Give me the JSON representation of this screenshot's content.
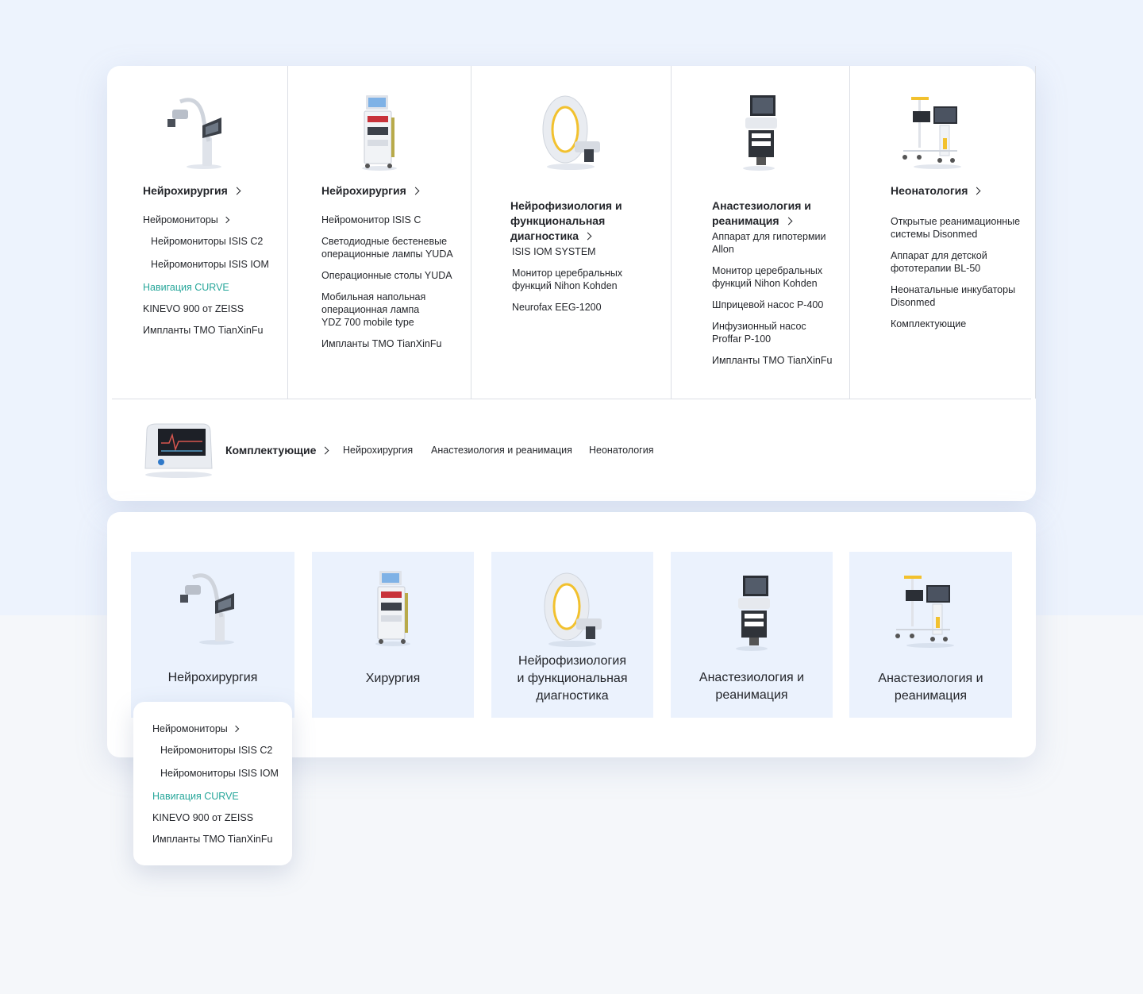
{
  "columns": [
    {
      "title": "Нейрохирургия",
      "icon": "surgical-microscope-icon",
      "items": [
        {
          "label": "Нейромониторы",
          "type": "parent"
        },
        {
          "label": "Нейромониторы ISIS C2",
          "type": "sub"
        },
        {
          "label": "Нейромониторы ISIS IOM",
          "type": "sub"
        },
        {
          "label": "Навигация CURVE",
          "type": "accent"
        },
        {
          "label": "KINEVO 900 от ZEISS",
          "type": "normal"
        },
        {
          "label": "Импланты ТМО TianXinFu",
          "type": "normal"
        }
      ]
    },
    {
      "title": "Нейрохирургия",
      "icon": "equipment-cart-icon",
      "items": [
        {
          "label": "Нейромонитор ISIS C",
          "type": "normal"
        },
        {
          "label": "Светодиодные бестеневые\nоперационные лампы YUDA",
          "type": "normal"
        },
        {
          "label": "Операционные столы YUDA",
          "type": "normal"
        },
        {
          "label": "Мобильная напольная\nоперационная лампа\nYDZ 700 mobile type",
          "type": "normal"
        },
        {
          "label": "Импланты ТМО TianXinFu",
          "type": "normal"
        }
      ]
    },
    {
      "title": "Нейрофизиология и\nфункциональная\nдиагностика",
      "icon": "mri-scanner-icon",
      "items": [
        {
          "label": "ISIS IOM SYSTEM",
          "type": "normal"
        },
        {
          "label": "Монитор церебральных\nфункций Nihon Kohden",
          "type": "normal"
        },
        {
          "label": "Neurofax EEG-1200",
          "type": "normal"
        }
      ]
    },
    {
      "title": "Анастезиология и\nреанимация",
      "icon": "ultrasound-machine-icon",
      "items": [
        {
          "label": "Аппарат для гипотермии\nAllon",
          "type": "normal"
        },
        {
          "label": "Монитор церебральных\nфункций Nihon Kohden",
          "type": "normal"
        },
        {
          "label": "Шприцевой насос Р-400",
          "type": "normal"
        },
        {
          "label": "Инфузионный насос\nProffar P-100",
          "type": "normal"
        },
        {
          "label": "Импланты ТМО TianXinFu",
          "type": "normal"
        }
      ]
    },
    {
      "title": "Неонатология",
      "icon": "neonatal-warmer-icon",
      "items": [
        {
          "label": "Открытые реанимационные\nсистемы Disonmed",
          "type": "normal"
        },
        {
          "label": "Аппарат для детской\nфототерапии BL-50",
          "type": "normal"
        },
        {
          "label": "Неонатальные инкубаторы\nDisonmed",
          "type": "normal"
        },
        {
          "label": "Комплектующие",
          "type": "normal"
        }
      ]
    }
  ],
  "accessories": {
    "title": "Комплектующие",
    "links": [
      "Нейрохирургия",
      "Анастезиология и реанимация",
      "Неонатология"
    ]
  },
  "cards": [
    {
      "title": "Нейрохирургия"
    },
    {
      "title": "Хирургия"
    },
    {
      "title": "Нейрофизиология\nи функциональная\nдиагностика"
    },
    {
      "title": "Анастезиология и\nреанимация"
    },
    {
      "title": "Анастезиология и\nреанимация"
    }
  ],
  "dropdown": {
    "items": [
      {
        "label": "Нейромониторы",
        "type": "parent"
      },
      {
        "label": "Нейромониторы ISIS C2",
        "type": "sub"
      },
      {
        "label": "Нейромониторы ISIS IOM",
        "type": "sub"
      },
      {
        "label": "Навигация CURVE",
        "type": "accent"
      },
      {
        "label": "KINEVO 900 от ZEISS",
        "type": "normal"
      },
      {
        "label": "Импланты ТМО TianXinFu",
        "type": "normal"
      }
    ]
  },
  "colors": {
    "accent": "#26a69a",
    "card_bg": "#ebf2fd",
    "page_bg_top": "#edf3fd",
    "page_bg_bottom": "#f5f7fa"
  }
}
